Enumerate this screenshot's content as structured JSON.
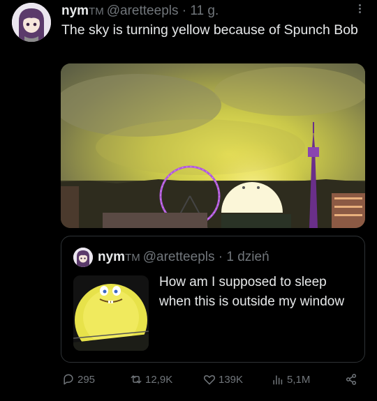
{
  "tweet": {
    "display_name": "nym",
    "tm": "TM",
    "handle": "@aretteepls",
    "separator": "·",
    "time": "11 g.",
    "text": "The sky is turning yellow because of Spunch Bob"
  },
  "quoted": {
    "display_name": "nym",
    "tm": "TM",
    "handle": "@aretteepls",
    "separator": "·",
    "time": "1 dzień",
    "text": "How am I supposed to sleep when this is outside my window"
  },
  "actions": {
    "replies": "295",
    "reposts": "12,9K",
    "likes": "139K",
    "views": "5,1M"
  },
  "icons": [
    "more-icon",
    "reply-icon",
    "repost-icon",
    "like-icon",
    "views-icon",
    "share-icon"
  ],
  "colors": {
    "background": "#000000",
    "text": "#e7e9ea",
    "muted": "#71767b",
    "border": "#2f3336",
    "sky_yellow": "#d9d84a"
  }
}
